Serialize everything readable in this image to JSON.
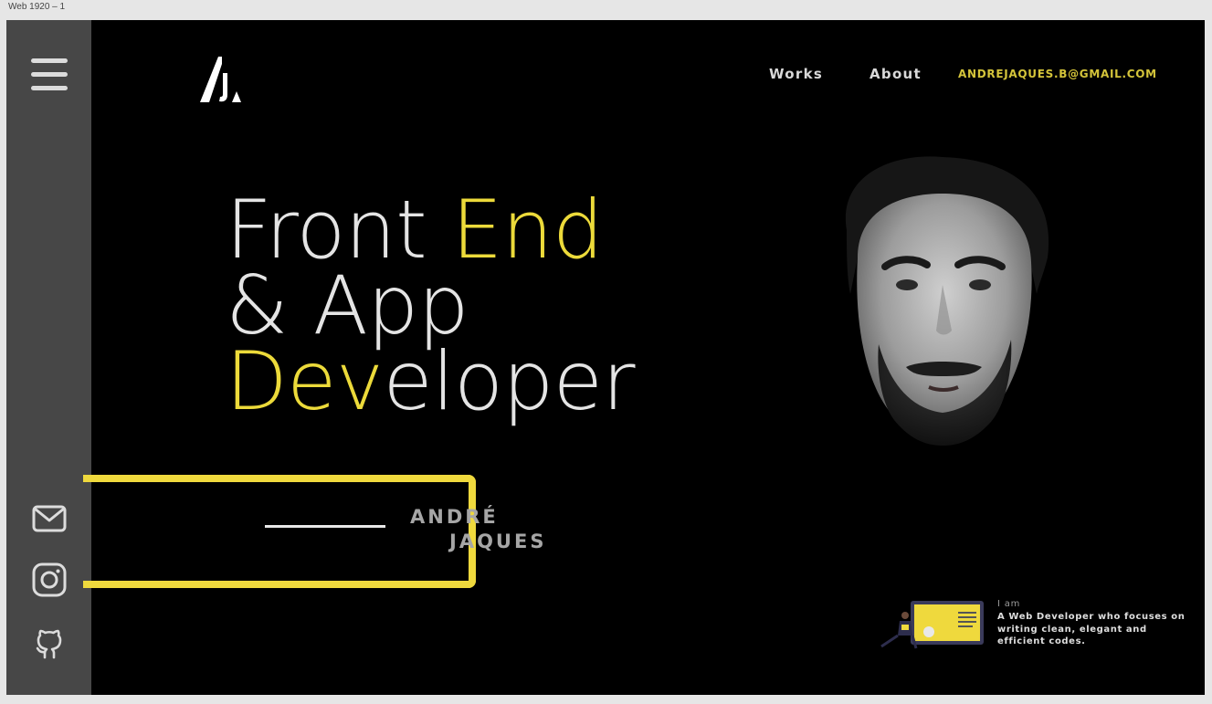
{
  "frame": {
    "title": "Web 1920 – 1"
  },
  "nav": {
    "works": "Works",
    "about": "About",
    "email": "ANDREJAQUES.B@GMAIL.COM"
  },
  "hero": {
    "line1_a": "Front ",
    "line1_b": "End",
    "line2": "& App",
    "line3_a": "Dev",
    "line3_b": "eloper"
  },
  "name": {
    "first": "ANDRÉ",
    "last": "JAQUES"
  },
  "intro": {
    "label": "I am",
    "description": "A Web Developer who focuses on writing clean, elegant and efficient codes."
  },
  "icons": {
    "menu": "hamburger-menu-icon",
    "mail": "mail-icon",
    "instagram": "instagram-icon",
    "github": "github-icon"
  },
  "colors": {
    "accent": "#ecda3a",
    "sidebar": "#474747",
    "background": "#000000",
    "email": "#d4c43a"
  }
}
